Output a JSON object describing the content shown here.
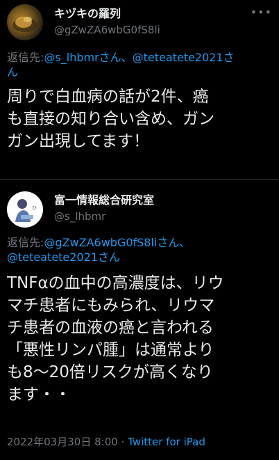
{
  "tweet1": {
    "display_name": "キヅキの羅列",
    "handle": "@gZwZA6wbG0fS8li",
    "reply_label": "返信先:",
    "reply_to": [
      "@s_lhbmrさん、",
      "@teteatete2021さ",
      "ん"
    ],
    "text_lines": [
      "周りで白血病の話が2件、癌",
      "も直接の知り合い含め、ガン",
      "ガン出現してます！"
    ],
    "more_icon": "more-dots-icon"
  },
  "tweet2": {
    "display_name": "富一情報総合研究室",
    "handle": "@s_lhbmr",
    "reply_label": "返信先:",
    "reply_to": [
      "@gZwZA6wbG0fS8liさん、",
      "@teteatete2021さん"
    ],
    "text_lines": [
      "TNFαの血中の高濃度は、リウ",
      "マチ患者にもみられ、リウマ",
      "チ患者の血液の癌と言われる",
      "「悪性リンパ腫」は通常より",
      "も8〜20倍リスクが高くなり",
      "ます・・"
    ],
    "timestamp": "2022年03月30日 8:00",
    "separator": "·",
    "client": "Twitter for iPad"
  }
}
